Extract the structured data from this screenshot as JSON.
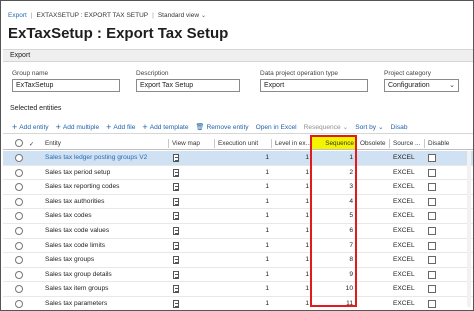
{
  "breadcrumb": {
    "items": [
      "Export",
      "EXTAXSETUP : EXPORT TAX SETUP",
      "Standard view"
    ]
  },
  "page": {
    "title": "ExTaxSetup : Export Tax Setup"
  },
  "export_section": {
    "label": "Export",
    "fields": {
      "group_name": {
        "label": "Group name",
        "value": "ExTaxSetup"
      },
      "description": {
        "label": "Description",
        "value": "Export Tax Setup"
      },
      "data_project_operation_type": {
        "label": "Data project operation type",
        "value": "Export"
      },
      "project_category": {
        "label": "Project category",
        "value": "Configuration"
      }
    }
  },
  "entities_section": {
    "label": "Selected entities"
  },
  "toolbar": {
    "add_entity": "Add entity",
    "add_multiple": "Add multiple",
    "add_file": "Add file",
    "add_template": "Add template",
    "remove_entity": "Remove entity",
    "open_in_excel": "Open in Excel",
    "resequence": "Resequence",
    "sort_by": "Sort by",
    "disable": "Disab"
  },
  "grid": {
    "columns": {
      "entity": "Entity",
      "view_map": "View map",
      "execution_unit": "Execution unit",
      "level_in_execution": "Level in ex...",
      "sequence": "Sequence",
      "obsolete": "Obsolete",
      "source_data_format": "Source ...",
      "disable": "Disable"
    },
    "rows": [
      {
        "entity": "Sales tax ledger posting groups V2",
        "execution_unit": "1",
        "level": "1",
        "sequence": "1",
        "source": "EXCEL"
      },
      {
        "entity": "Sales tax period setup",
        "execution_unit": "1",
        "level": "1",
        "sequence": "2",
        "source": "EXCEL"
      },
      {
        "entity": "Sales tax reporting codes",
        "execution_unit": "1",
        "level": "1",
        "sequence": "3",
        "source": "EXCEL"
      },
      {
        "entity": "Sales tax authorities",
        "execution_unit": "1",
        "level": "1",
        "sequence": "4",
        "source": "EXCEL"
      },
      {
        "entity": "Sales tax codes",
        "execution_unit": "1",
        "level": "1",
        "sequence": "5",
        "source": "EXCEL"
      },
      {
        "entity": "Sales tax code values",
        "execution_unit": "1",
        "level": "1",
        "sequence": "6",
        "source": "EXCEL"
      },
      {
        "entity": "Sales tax code limits",
        "execution_unit": "1",
        "level": "1",
        "sequence": "7",
        "source": "EXCEL"
      },
      {
        "entity": "Sales tax groups",
        "execution_unit": "1",
        "level": "1",
        "sequence": "8",
        "source": "EXCEL"
      },
      {
        "entity": "Sales tax group details",
        "execution_unit": "1",
        "level": "1",
        "sequence": "9",
        "source": "EXCEL"
      },
      {
        "entity": "Sales tax item groups",
        "execution_unit": "1",
        "level": "1",
        "sequence": "10",
        "source": "EXCEL"
      },
      {
        "entity": "Sales tax parameters",
        "execution_unit": "1",
        "level": "1",
        "sequence": "11",
        "source": "EXCEL"
      }
    ]
  },
  "colors": {
    "link": "#2a6ab0",
    "selected_row": "#cfe1f3",
    "highlight_border": "#e01b1b",
    "sequence_header_fill": "#f5f400"
  }
}
